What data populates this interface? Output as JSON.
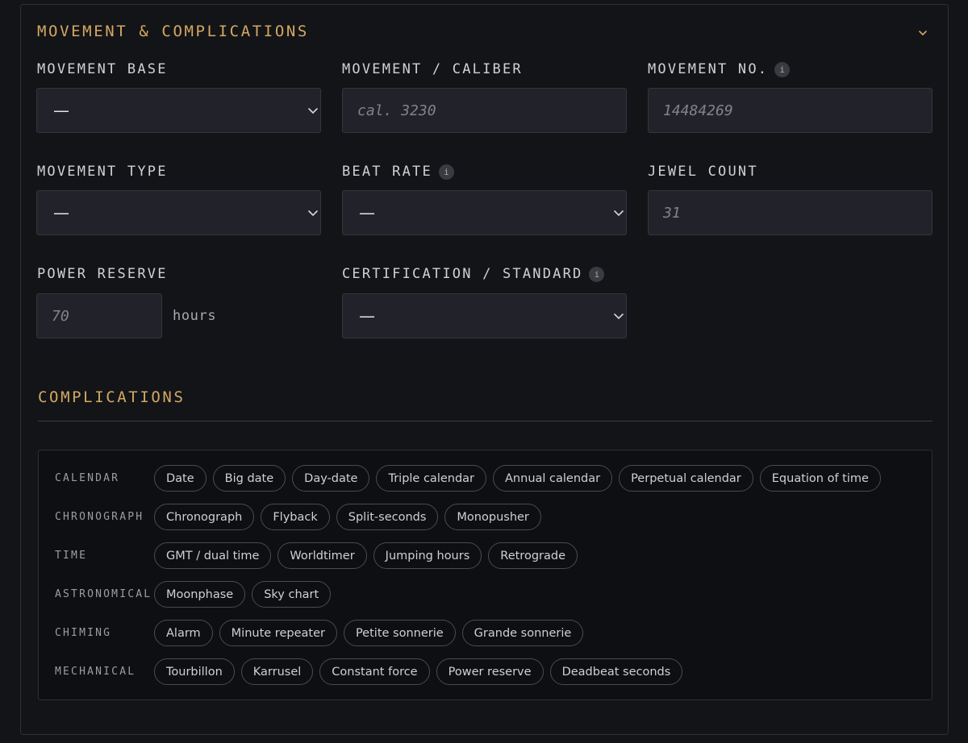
{
  "section": {
    "title": "MOVEMENT & COMPLICATIONS"
  },
  "fields": {
    "movement_base": {
      "label": "MOVEMENT BASE",
      "value": "—"
    },
    "movement_caliber": {
      "label": "MOVEMENT / CALIBER",
      "placeholder": "cal. 3230"
    },
    "movement_no": {
      "label": "MOVEMENT NO.",
      "placeholder": "14484269",
      "info": "i"
    },
    "movement_type": {
      "label": "MOVEMENT TYPE",
      "value": "—"
    },
    "beat_rate": {
      "label": "BEAT RATE",
      "value": "—",
      "info": "i"
    },
    "jewel_count": {
      "label": "JEWEL COUNT",
      "placeholder": "31"
    },
    "power_reserve": {
      "label": "POWER RESERVE",
      "placeholder": "70",
      "unit": "hours"
    },
    "certification": {
      "label": "CERTIFICATION / STANDARD",
      "value": "—",
      "info": "i"
    }
  },
  "complications": {
    "title": "COMPLICATIONS",
    "categories": [
      {
        "label": "CALENDAR",
        "chips": [
          "Date",
          "Big date",
          "Day-date",
          "Triple calendar",
          "Annual calendar",
          "Perpetual calendar",
          "Equation of time"
        ]
      },
      {
        "label": "CHRONOGRAPH",
        "chips": [
          "Chronograph",
          "Flyback",
          "Split-seconds",
          "Monopusher"
        ]
      },
      {
        "label": "TIME",
        "chips": [
          "GMT / dual time",
          "Worldtimer",
          "Jumping hours",
          "Retrograde"
        ]
      },
      {
        "label": "ASTRONOMICAL",
        "chips": [
          "Moonphase",
          "Sky chart"
        ]
      },
      {
        "label": "CHIMING",
        "chips": [
          "Alarm",
          "Minute repeater",
          "Petite sonnerie",
          "Grande sonnerie"
        ]
      },
      {
        "label": "MECHANICAL",
        "chips": [
          "Tourbillon",
          "Karrusel",
          "Constant force",
          "Power reserve",
          "Deadbeat seconds"
        ]
      }
    ]
  },
  "icons": {
    "collapse": "chevron-down-icon",
    "select": "chevron-down-icon",
    "info": "info-icon"
  },
  "colors": {
    "accent": "#d3a864",
    "background": "#131417",
    "control_bg": "#22232a"
  }
}
